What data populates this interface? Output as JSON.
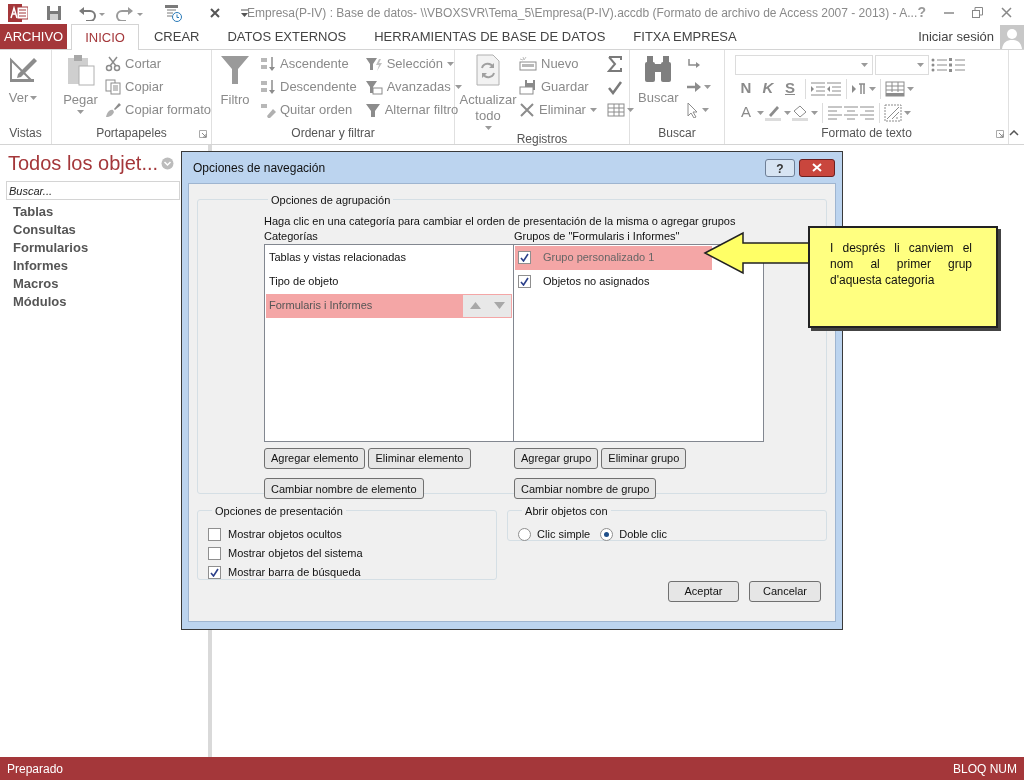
{
  "title_bar": {
    "title": "Empresa(P-IV) : Base de datos- \\\\VBOXSVR\\Tema_5\\Empresa(P-IV).accdb (Formato de archivo de Access 2007 - 2013) - A...",
    "help": "?"
  },
  "ribbon": {
    "tabs": [
      {
        "label": "ARCHIVO",
        "kind": "file",
        "selected": false
      },
      {
        "label": "INICIO",
        "kind": "tab",
        "selected": true
      },
      {
        "label": "CREAR",
        "kind": "tab",
        "selected": false
      },
      {
        "label": "DATOS EXTERNOS",
        "kind": "tab",
        "selected": false
      },
      {
        "label": "HERRAMIENTAS DE BASE DE DATOS",
        "kind": "tab",
        "selected": false
      },
      {
        "label": "FITXA EMPRESA",
        "kind": "tab",
        "selected": false
      }
    ],
    "account": "Iniciar sesión",
    "groups": [
      {
        "label": "Vistas",
        "large": [
          {
            "label": "Ver",
            "disabled": true
          }
        ]
      },
      {
        "label": "Portapapeles",
        "large": [
          {
            "label": "Pegar",
            "disabled": true
          }
        ],
        "small": [
          {
            "label": "Cortar",
            "disabled": true
          },
          {
            "label": "Copiar",
            "disabled": true
          },
          {
            "label": "Copiar formato",
            "disabled": true
          }
        ]
      },
      {
        "label": "Ordenar y filtrar",
        "large": [
          {
            "label": "Filtro",
            "disabled": true
          }
        ],
        "small": [
          {
            "label": "Ascendente",
            "disabled": true
          },
          {
            "label": "Descendente",
            "disabled": true
          },
          {
            "label": "Quitar orden",
            "disabled": true
          },
          {
            "label": "Selección",
            "disabled": true
          },
          {
            "label": "Avanzadas",
            "disabled": true
          },
          {
            "label": "Alternar filtro",
            "disabled": true
          }
        ]
      },
      {
        "label": "Registros",
        "large": [
          {
            "label": "Actualizar todo",
            "disabled": true
          }
        ],
        "small": [
          {
            "label": "Nuevo",
            "disabled": true
          },
          {
            "label": "Guardar",
            "disabled": true
          },
          {
            "label": "Eliminar",
            "disabled": true
          }
        ]
      },
      {
        "label": "Buscar",
        "large": [
          {
            "label": "Buscar",
            "disabled": true
          }
        ]
      },
      {
        "label": "Formato de texto",
        "format_buttons": [
          "N",
          "K",
          "S",
          "A"
        ]
      }
    ]
  },
  "nav_pane": {
    "title": "Todos los objet...",
    "search_placeholder": "Buscar...",
    "items": [
      "Tablas",
      "Consultas",
      "Formularios",
      "Informes",
      "Macros",
      "Módulos"
    ]
  },
  "dialog": {
    "title": "Opciones de navegación",
    "help": "?",
    "grouping": {
      "legend": "Opciones de agrupación",
      "instructions": "Haga clic en una categoría para cambiar el orden de presentación de la misma o agregar grupos",
      "categories_label": "Categorías",
      "groups_label": "Grupos de \"Formularis i Informes\"",
      "categories": [
        {
          "label": "Tablas y vistas relacionadas",
          "selected": false
        },
        {
          "label": "Tipo de objeto",
          "selected": false
        },
        {
          "label": "Formularis i Informes",
          "selected": true
        }
      ],
      "groups": [
        {
          "label": "Grupo personalizado 1",
          "checked": true,
          "selected": true
        },
        {
          "label": "Objetos no asignados",
          "checked": true,
          "selected": false
        }
      ],
      "category_buttons": [
        "Agregar elemento",
        "Eliminar elemento",
        "Cambiar nombre de elemento"
      ],
      "group_buttons": [
        "Agregar grupo",
        "Eliminar grupo",
        "Cambiar nombre de grupo"
      ]
    },
    "display": {
      "legend": "Opciones de presentación",
      "options": [
        {
          "label": "Mostrar objetos ocultos",
          "checked": false
        },
        {
          "label": "Mostrar objetos del sistema",
          "checked": false
        },
        {
          "label": "Mostrar barra de búsqueda",
          "checked": true
        }
      ]
    },
    "open_with": {
      "legend": "Abrir objetos con",
      "options": [
        {
          "label": "Clic simple",
          "selected": false
        },
        {
          "label": "Doble clic",
          "selected": true
        }
      ]
    },
    "buttons": [
      "Aceptar",
      "Cancelar"
    ]
  },
  "callout": {
    "text": "I després li canviem el nom al primer grup d'aquesta categoria"
  },
  "status_bar": {
    "left": "Preparado",
    "right": "BLOQ NUM"
  }
}
